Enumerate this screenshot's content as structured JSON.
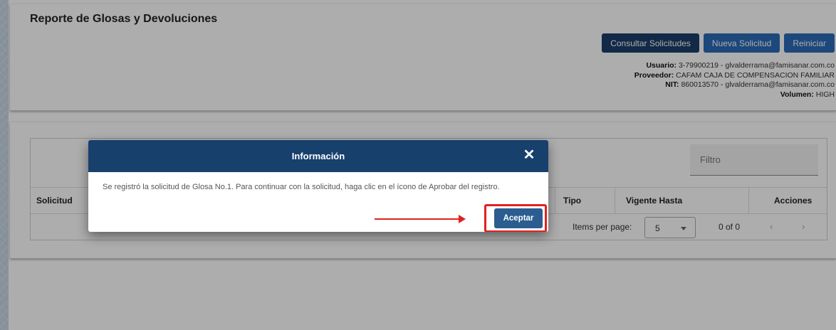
{
  "page": {
    "title": "Reporte de Glosas y Devoluciones"
  },
  "toolbar": {
    "consultar_label": "Consultar Solicitudes",
    "nueva_label": "Nueva Solicitud",
    "reiniciar_label": "Reiniciar"
  },
  "user_info": {
    "usuario_label": "Usuario:",
    "usuario_value": "3-79900219 - glvalderrama@famisanar.com.co",
    "proveedor_label": "Proveedor:",
    "proveedor_value": "CAFAM CAJA DE COMPENSACION FAMILIAR",
    "nit_label": "NIT:",
    "nit_value": "860013570 - glvalderrama@famisanar.com.co",
    "volumen_label": "Volumen:",
    "volumen_value": "HIGH"
  },
  "table": {
    "filter_placeholder": "Filtro",
    "columns": {
      "solicitud": "Solicitud",
      "tipo": "Tipo",
      "vigente_hasta": "Vigente Hasta",
      "acciones": "Acciones"
    },
    "paginator": {
      "items_per_page_label": "Items per page:",
      "page_size": "5",
      "range": "0 of 0",
      "prev_icon": "chevron-left-icon",
      "next_icon": "chevron-right-icon"
    }
  },
  "dialog": {
    "title": "Información",
    "message": "Se registró la solicitud de Glosa No.1. Para continuar con la solicitud, haga clic en el ícono de Aprobar del registro.",
    "accept_label": "Aceptar",
    "close_icon": "close-icon"
  },
  "colors": {
    "primary_dark": "#1b3e69",
    "primary_blue": "#2c6ab5",
    "dialog_header": "#17406d",
    "highlight_red": "#e0221f"
  }
}
